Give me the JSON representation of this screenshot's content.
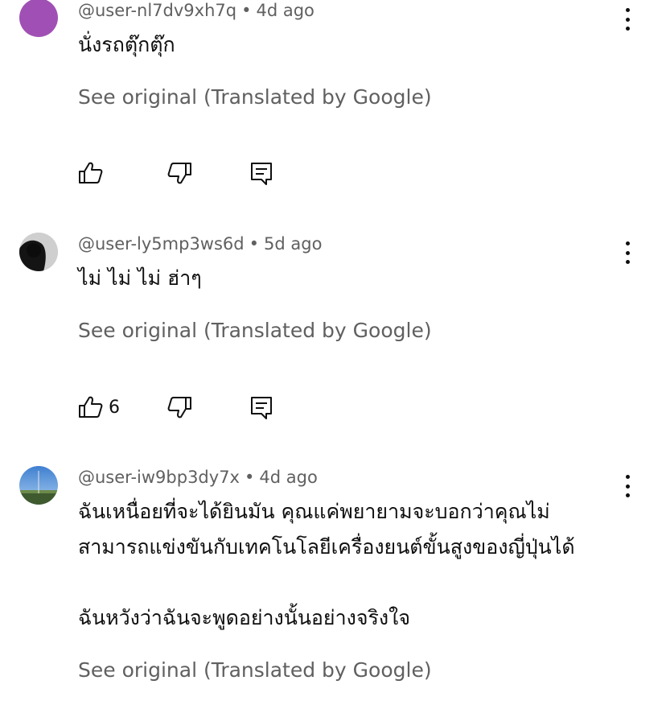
{
  "comments": [
    {
      "handle": "@user-nl7dv9xh7q",
      "separator": "•",
      "time": "4d ago",
      "text": "นั่งรถตุ๊กตุ๊ก",
      "see_original": "See original (Translated by Google)",
      "like_count": "",
      "avatar_color": "#a050b4"
    },
    {
      "handle": "@user-ly5mp3ws6d",
      "separator": "•",
      "time": "5d ago",
      "text": "ไม่ ไม่ ไม่ ฮ่าๆ",
      "see_original": "See original (Translated by Google)",
      "like_count": "6",
      "avatar_color": "#2a2a2a"
    },
    {
      "handle": "@user-iw9bp3dy7x",
      "separator": "•",
      "time": "4d ago",
      "text": "ฉันเหนื่อยที่จะได้ยินมัน คุณแค่พยายามจะบอกว่าคุณไม่\nสามารถแข่งขันกับเทคโนโลยีเครื่องยนต์ขั้นสูงของญี่ปุ่นได้\n\nฉันหวังว่าฉันจะพูดอย่างนั้นอย่างจริงใจ",
      "see_original": "See original (Translated by Google)",
      "like_count": "",
      "avatar_color": "#5a8fd0"
    }
  ],
  "icons": {
    "like": "thumbs-up-icon",
    "dislike": "thumbs-down-icon",
    "reply": "reply-icon",
    "menu": "more-vert-icon"
  }
}
